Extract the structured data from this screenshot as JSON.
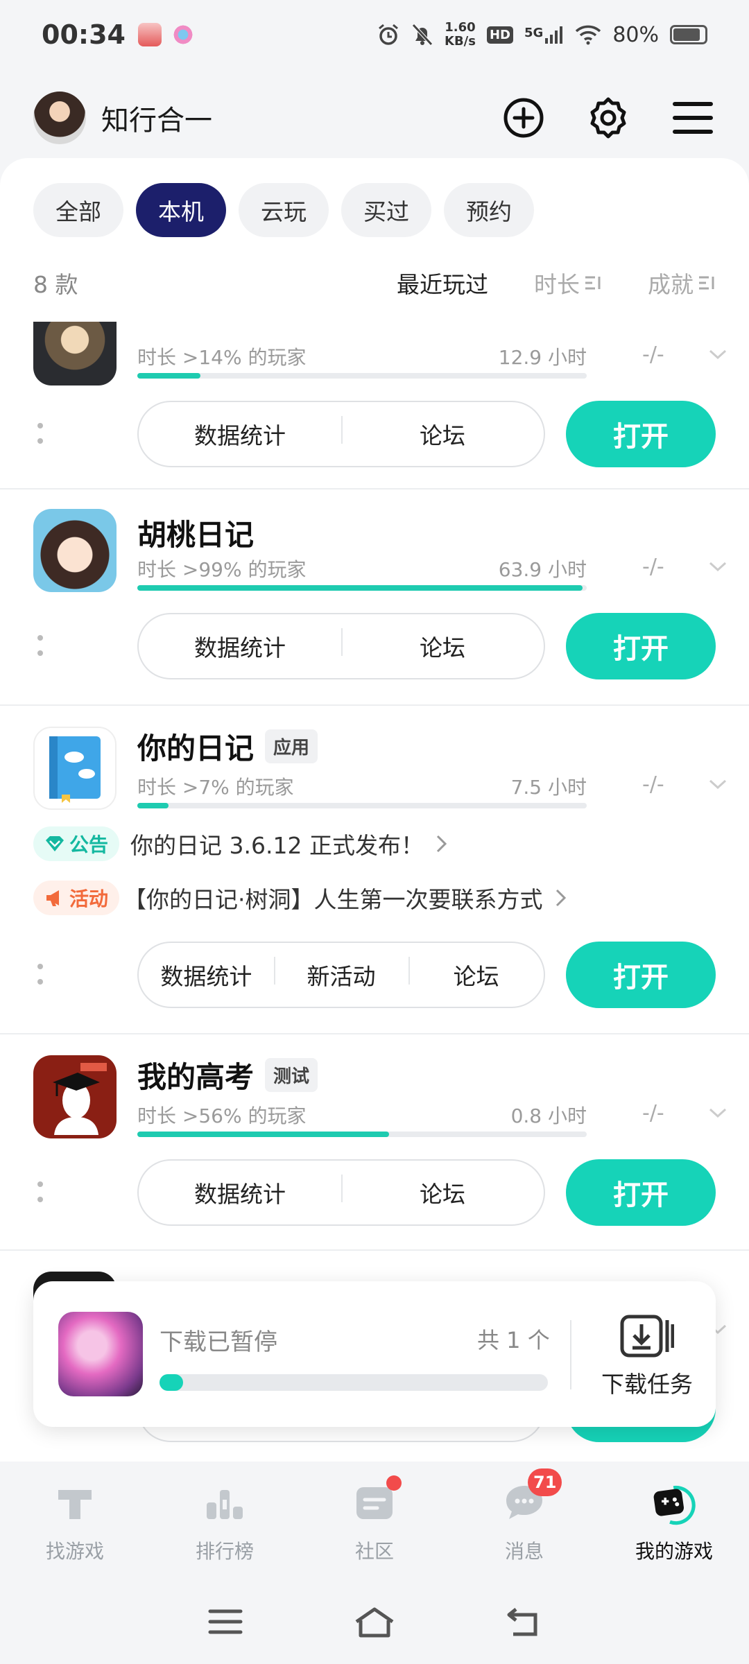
{
  "status": {
    "time": "00:34",
    "net_speed_value": "1.60",
    "net_speed_unit": "KB/s",
    "hd": "HD",
    "network": "5G",
    "battery": "80%"
  },
  "header": {
    "username": "知行合一"
  },
  "tabs": [
    "全部",
    "本机",
    "云玩",
    "买过",
    "预约"
  ],
  "active_tab": "本机",
  "sortbar": {
    "count": "8 款",
    "sorts": [
      "最近玩过",
      "时长",
      "成就"
    ]
  },
  "games": [
    {
      "name": "",
      "tag": "",
      "stat": "时长 >14% 的玩家",
      "hours": "12.9 小时",
      "progress": 0.14,
      "achievement": "-/-",
      "actions": [
        "数据统计",
        "论坛"
      ],
      "open_label": "打开"
    },
    {
      "name": "胡桃日记",
      "tag": "",
      "stat": "时长 >99% 的玩家",
      "hours": "63.9 小时",
      "progress": 0.99,
      "achievement": "-/-",
      "actions": [
        "数据统计",
        "论坛"
      ],
      "open_label": "打开"
    },
    {
      "name": "你的日记",
      "tag": "应用",
      "stat": "时长 >7% 的玩家",
      "hours": "7.5 小时",
      "progress": 0.07,
      "achievement": "-/-",
      "notice_announce_label": "公告",
      "notice_announce_text": "你的日记 3.6.12 正式发布！",
      "notice_activity_label": "活动",
      "notice_activity_text": "【你的日记·树洞】人生第一次要联系方式",
      "actions": [
        "数据统计",
        "新活动",
        "论坛"
      ],
      "open_label": "打开"
    },
    {
      "name": "我的高考",
      "tag": "测试",
      "stat": "时长 >56% 的玩家",
      "hours": "0.8 小时",
      "progress": 0.56,
      "achievement": "-/-",
      "actions": [
        "数据统计",
        "论坛"
      ],
      "open_label": "打开"
    }
  ],
  "download": {
    "title": "下载已暂停",
    "total": "共 1 个",
    "progress": 0.06,
    "task_label": "下载任务"
  },
  "bottom_nav": [
    {
      "label": "找游戏",
      "icon": "find-game-icon"
    },
    {
      "label": "排行榜",
      "icon": "ranking-icon"
    },
    {
      "label": "社区",
      "icon": "community-icon"
    },
    {
      "label": "消息",
      "icon": "message-icon",
      "badge": "71"
    },
    {
      "label": "我的游戏",
      "icon": "my-games-icon"
    }
  ],
  "colors": {
    "accent": "#16d3b8",
    "active_tab": "#1c1f6b",
    "badge_red": "#f24b4b"
  }
}
